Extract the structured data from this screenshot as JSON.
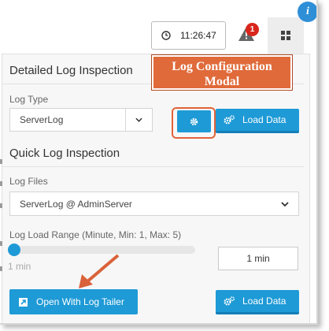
{
  "header": {
    "time": "11:26:47",
    "alert_count": "1",
    "info_glyph": "i",
    "icons": [
      "clock-icon",
      "warning-icon",
      "grid-icon",
      "info-icon"
    ]
  },
  "callout": {
    "line1": "Log Configuration",
    "line2": "Modal"
  },
  "detailed": {
    "title": "Detailed Log Inspection",
    "log_type_label": "Log Type",
    "log_type_value": "ServerLog",
    "load_data_label": "Load Data"
  },
  "quick": {
    "title": "Quick Log Inspection",
    "log_files_label": "Log Files",
    "log_files_value": "ServerLog @ AdminServer",
    "range_label": "Log Load Range (Minute, Min: 1, Max: 5)",
    "slider_min_label": "1 min",
    "slider_fraction": 0,
    "range_value": "1 min",
    "open_tailer_label": "Open With Log Tailer",
    "load_data_label": "Load Data"
  },
  "colors": {
    "accent": "#1e9ad6",
    "callout": "#e06a3a",
    "badge": "#d9261c"
  }
}
